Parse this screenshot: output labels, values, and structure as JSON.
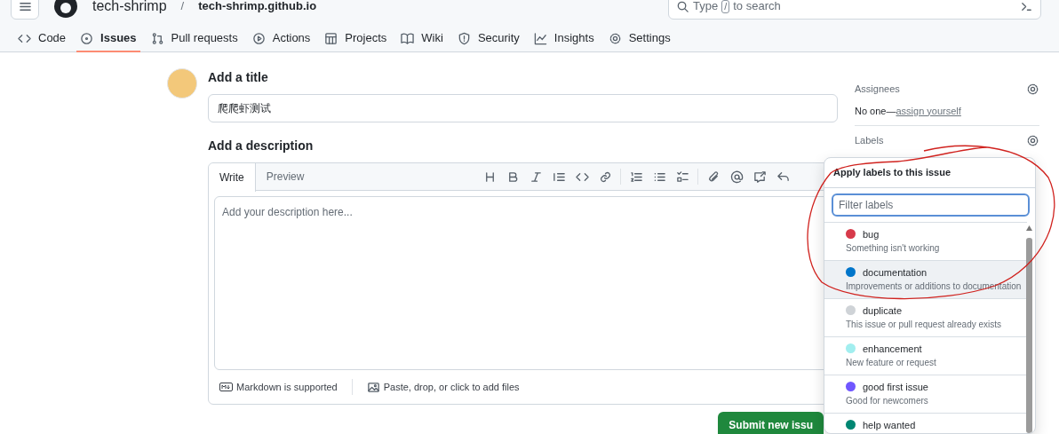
{
  "header": {
    "owner": "tech-shrimp",
    "separator": "/",
    "repo": "tech-shrimp.github.io",
    "search": {
      "placeholder_before": "Type",
      "key": "/",
      "placeholder_after": "to search"
    }
  },
  "tabs": [
    {
      "label": "Code",
      "selected": false
    },
    {
      "label": "Issues",
      "selected": true
    },
    {
      "label": "Pull requests",
      "selected": false
    },
    {
      "label": "Actions",
      "selected": false
    },
    {
      "label": "Projects",
      "selected": false
    },
    {
      "label": "Wiki",
      "selected": false
    },
    {
      "label": "Security",
      "selected": false
    },
    {
      "label": "Insights",
      "selected": false
    },
    {
      "label": "Settings",
      "selected": false
    }
  ],
  "form": {
    "title_heading": "Add a title",
    "title_value": "爬爬虾测试",
    "description_heading": "Add a description",
    "editor_tabs": [
      {
        "label": "Write",
        "selected": true
      },
      {
        "label": "Preview",
        "selected": false
      }
    ],
    "description_placeholder": "Add your description here...",
    "markdown_note": "Markdown is supported",
    "files_note": "Paste, drop, or click to add files",
    "submit": "Submit new issu"
  },
  "sidebar": {
    "assignees_heading": "Assignees",
    "assignees_text": "No one—",
    "assign_link": "assign yourself",
    "labels_heading": "Labels"
  },
  "labels_menu": {
    "title": "Apply labels to this issue",
    "filter_placeholder": "Filter labels",
    "items": [
      {
        "name": "bug",
        "description": "Something isn't working",
        "color": "#d73a4a",
        "highlighted": false
      },
      {
        "name": "documentation",
        "description": "Improvements or additions to documentation",
        "color": "#0075ca",
        "highlighted": true
      },
      {
        "name": "duplicate",
        "description": "This issue or pull request already exists",
        "color": "#cfd3d7",
        "highlighted": false
      },
      {
        "name": "enhancement",
        "description": "New feature or request",
        "color": "#a2eeef",
        "highlighted": false
      },
      {
        "name": "good first issue",
        "description": "Good for newcomers",
        "color": "#7057ff",
        "highlighted": false
      },
      {
        "name": "help wanted",
        "color": "#008672",
        "highlighted": false
      }
    ]
  }
}
